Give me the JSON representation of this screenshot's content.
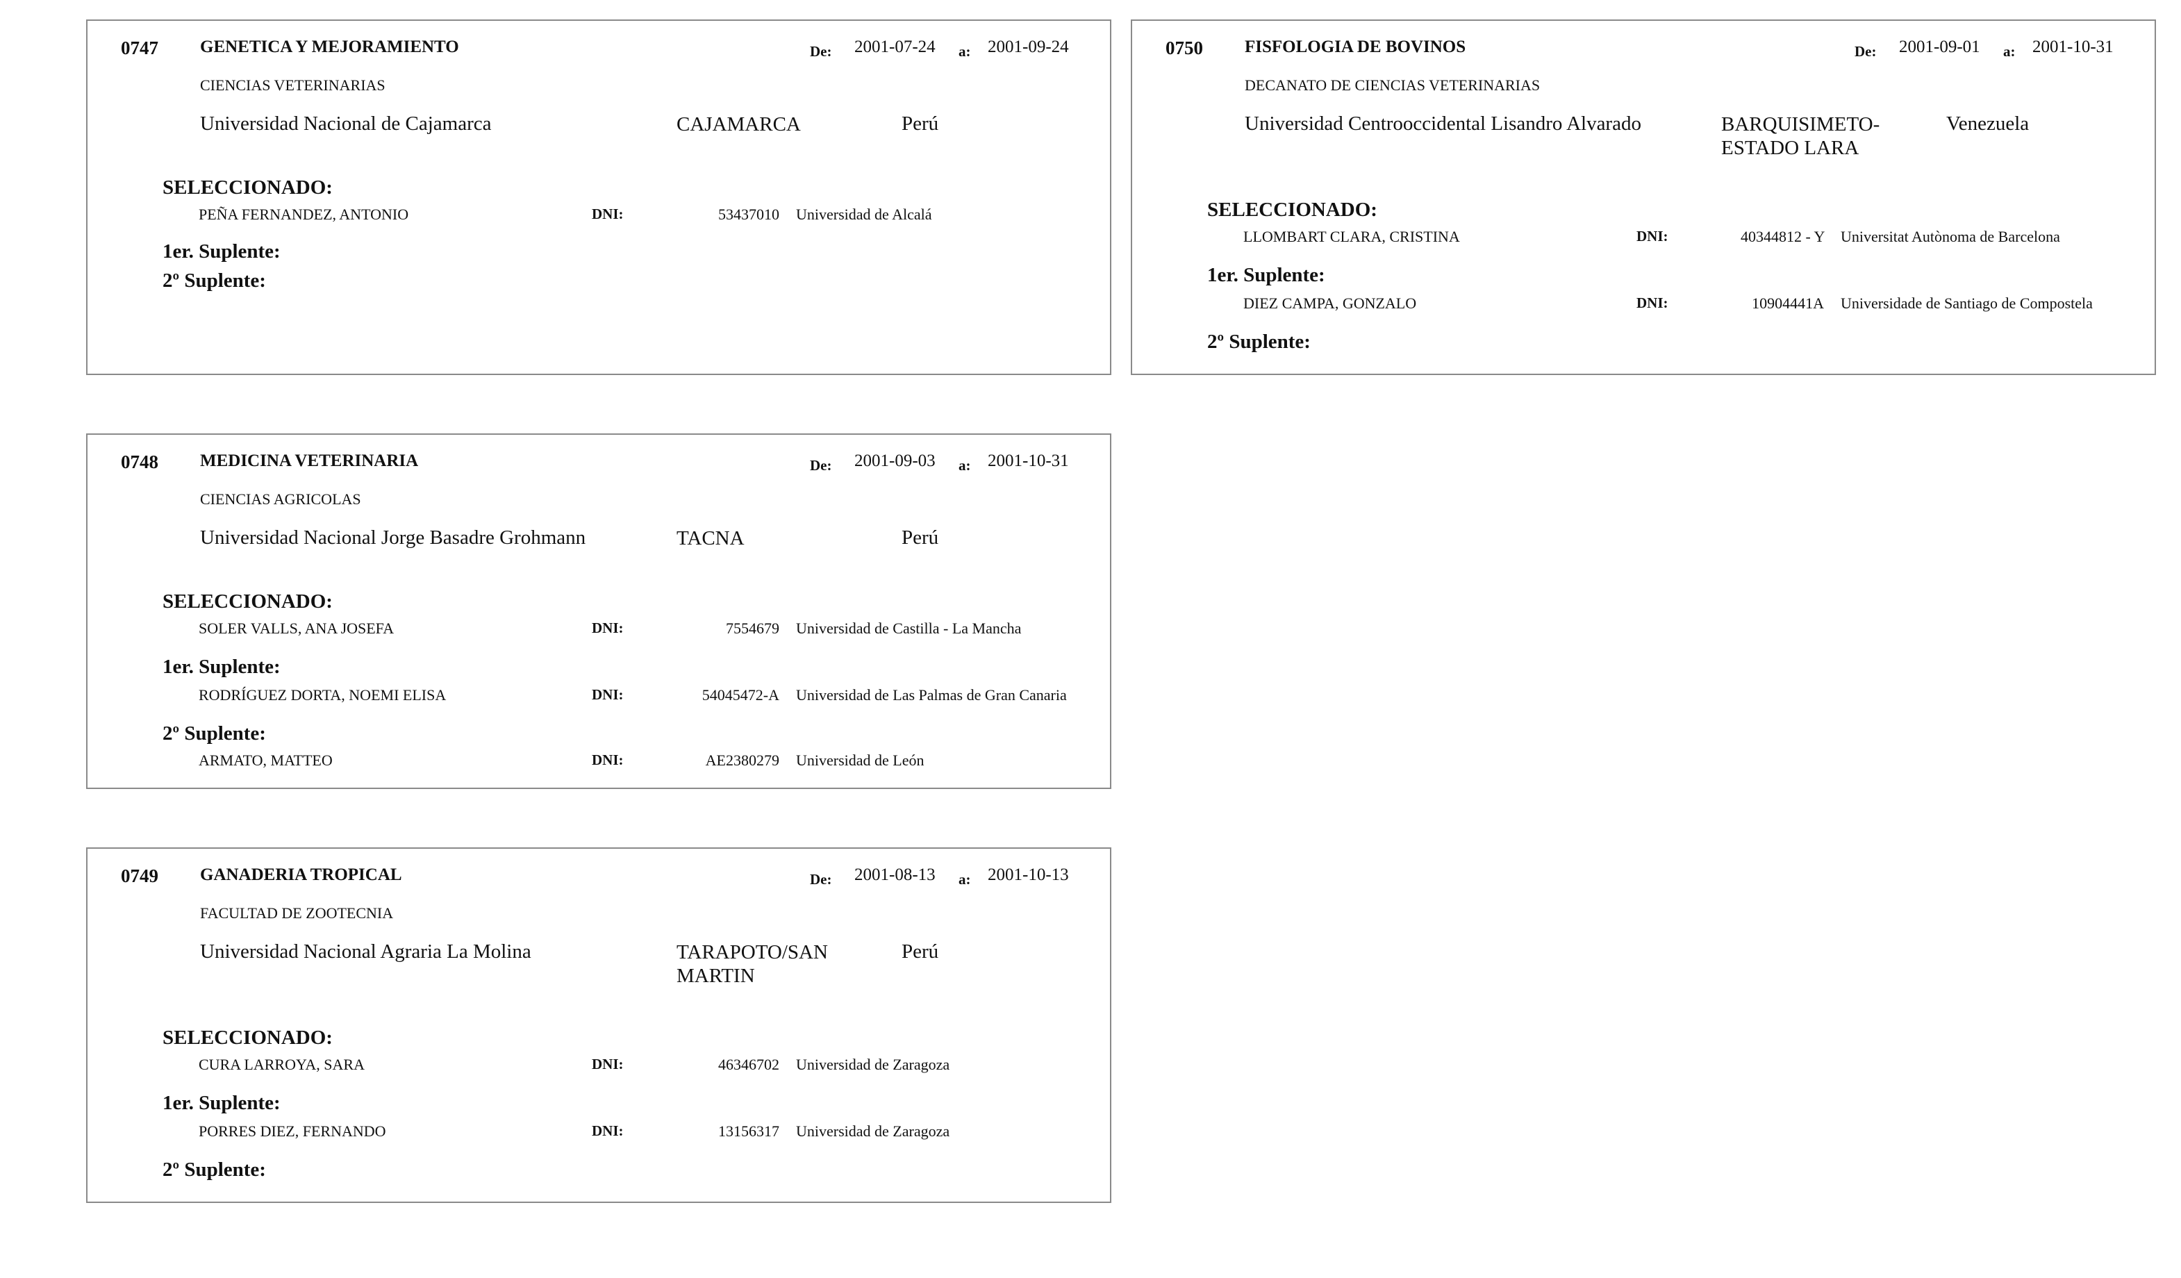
{
  "labels": {
    "de": "De:",
    "a": "a:",
    "seleccionado": "SELECCIONADO:",
    "suplente1": "1er. Suplente:",
    "suplente2": "2º Suplente:",
    "dni": "DNI:"
  },
  "cards": {
    "c0747": {
      "code": "0747",
      "title": "GENETICA Y MEJORAMIENTO",
      "date_from": "2001-07-24",
      "date_to": "2001-09-24",
      "faculty": "CIENCIAS VETERINARIAS",
      "university": "Universidad Nacional de Cajamarca",
      "city": "CAJAMARCA",
      "country": "Perú",
      "seleccionado": {
        "name": "PEÑA FERNANDEZ, ANTONIO",
        "dni": "53437010",
        "university": "Universidad de Alcalá"
      }
    },
    "c0750": {
      "code": "0750",
      "title": "FISFOLOGIA DE BOVINOS",
      "date_from": "2001-09-01",
      "date_to": "2001-10-31",
      "faculty": "DECANATO DE CIENCIAS VETERINARIAS",
      "university": "Universidad Centrooccidental Lisandro Alvarado",
      "city_line1": "BARQUISIMETO-",
      "city_line2": "ESTADO LARA",
      "country": "Venezuela",
      "seleccionado": {
        "name": "LLOMBART CLARA, CRISTINA",
        "dni": "40344812 - Y",
        "university": "Universitat Autònoma de Barcelona"
      },
      "suplente1": {
        "name": "DIEZ CAMPA, GONZALO",
        "dni": "10904441A",
        "university": "Universidade de Santiago de Compostela"
      }
    },
    "c0748": {
      "code": "0748",
      "title": "MEDICINA VETERINARIA",
      "date_from": "2001-09-03",
      "date_to": "2001-10-31",
      "faculty": "CIENCIAS AGRICOLAS",
      "university": "Universidad Nacional Jorge Basadre Grohmann",
      "city": "TACNA",
      "country": "Perú",
      "seleccionado": {
        "name": "SOLER VALLS, ANA JOSEFA",
        "dni": "7554679",
        "university": "Universidad de Castilla - La Mancha"
      },
      "suplente1": {
        "name": "RODRÍGUEZ DORTA, NOEMI ELISA",
        "dni": "54045472-A",
        "university": "Universidad de Las Palmas de Gran Canaria"
      },
      "suplente2": {
        "name": "ARMATO, MATTEO",
        "dni": "AE2380279",
        "university": "Universidad de León"
      }
    },
    "c0749": {
      "code": "0749",
      "title": "GANADERIA TROPICAL",
      "date_from": "2001-08-13",
      "date_to": "2001-10-13",
      "faculty": "FACULTAD DE ZOOTECNIA",
      "university": "Universidad Nacional Agraria La Molina",
      "city_line1": "TARAPOTO/SAN",
      "city_line2": "MARTIN",
      "country": "Perú",
      "seleccionado": {
        "name": "CURA LARROYA, SARA",
        "dni": "46346702",
        "university": "Universidad de Zaragoza"
      },
      "suplente1": {
        "name": "PORRES DIEZ, FERNANDO",
        "dni": "13156317",
        "university": "Universidad de Zaragoza"
      }
    }
  }
}
